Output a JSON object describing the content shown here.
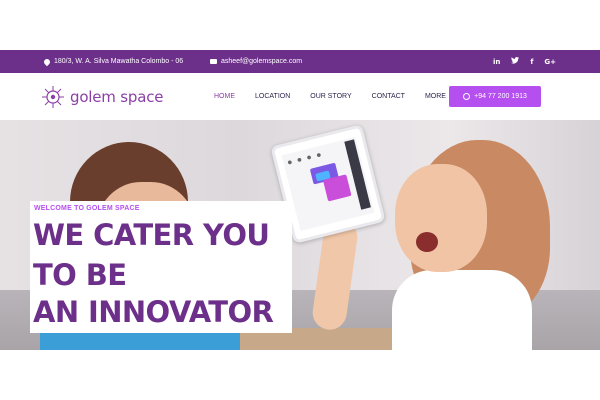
{
  "topbar": {
    "address": "180/3, W. A. Silva Mawatha Colombo - 06",
    "email": "asheef@golemspace.com",
    "social": [
      {
        "icon": "linkedin-icon",
        "label": "in"
      },
      {
        "icon": "twitter-icon",
        "label": "🐦"
      },
      {
        "icon": "facebook-icon",
        "label": "f"
      },
      {
        "icon": "google-plus-icon",
        "label": "G+"
      }
    ]
  },
  "nav": {
    "logo_text": "golem space",
    "items": [
      {
        "label": "HOME",
        "active": true
      },
      {
        "label": "LOCATION",
        "active": false
      },
      {
        "label": "OUR STORY",
        "active": false
      },
      {
        "label": "CONTACT",
        "active": false
      },
      {
        "label": "MORE",
        "active": false
      }
    ],
    "phone": "+94 77 200 1913"
  },
  "hero": {
    "eyebrow": "WELCOME TO GOLEM SPACE",
    "line1": "WE CATER YOU",
    "line2": "TO BE",
    "line3": "AN INNOVATOR"
  },
  "colors": {
    "brand_purple": "#6c2f8a",
    "accent_violet": "#b64ff0"
  }
}
